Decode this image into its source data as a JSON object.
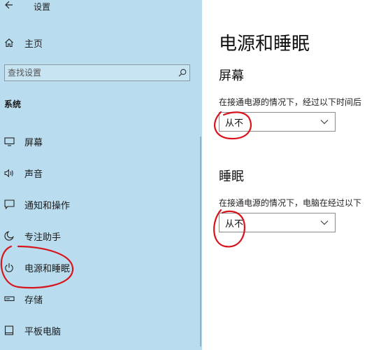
{
  "window": {
    "title": "设置"
  },
  "sidebar": {
    "home_label": "主页",
    "search": {
      "placeholder": "查找设置"
    },
    "section_heading": "系统",
    "items": [
      {
        "label": "屏幕",
        "icon": "monitor-icon"
      },
      {
        "label": "声音",
        "icon": "speaker-icon"
      },
      {
        "label": "通知和操作",
        "icon": "notification-icon"
      },
      {
        "label": "专注助手",
        "icon": "moon-icon"
      },
      {
        "label": "电源和睡眠",
        "icon": "power-icon",
        "selected": true
      },
      {
        "label": "存储",
        "icon": "storage-icon"
      },
      {
        "label": "平板电脑",
        "icon": "tablet-icon"
      }
    ]
  },
  "main": {
    "title": "电源和睡眠",
    "screen": {
      "heading": "屏幕",
      "description": "在接通电源的情况下，经过以下时间后",
      "value": "从不"
    },
    "sleep": {
      "heading": "睡眠",
      "description": "在接通电源的情况下，电脑在经过以下",
      "value": "从不"
    }
  },
  "colors": {
    "sidebar_bg": "#b9dcef",
    "main_bg": "#ffffff",
    "annotation_red": "#d8141c"
  }
}
